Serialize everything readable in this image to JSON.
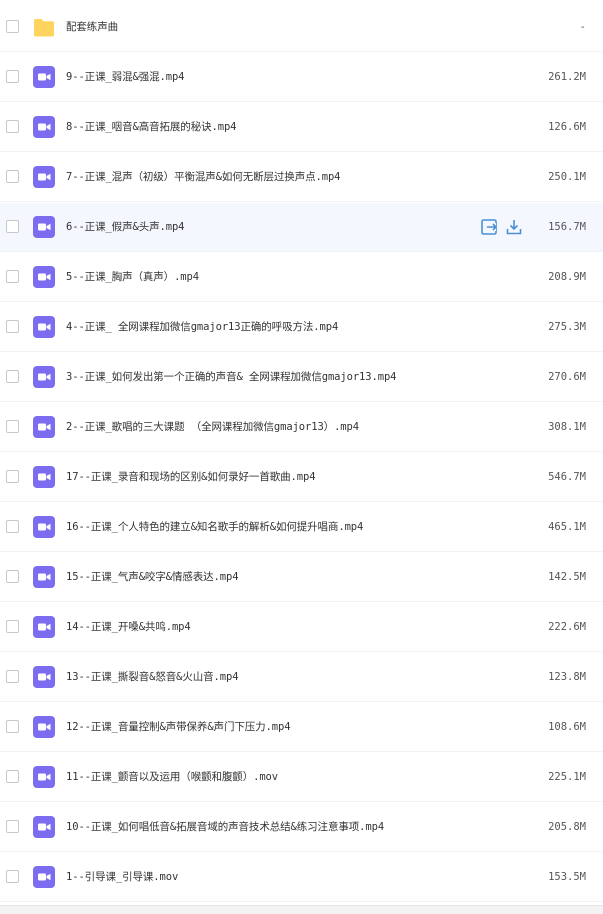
{
  "colors": {
    "folder": "#ffd45e",
    "video_icon": "#7b6cf0",
    "hover_row": "#f4f8fe",
    "action_icon": "#4a90d9"
  },
  "files": [
    {
      "name": "配套练声曲",
      "size": "-",
      "type": "folder",
      "icon": "folder-icon"
    },
    {
      "name": "9--正课_弱混&强混.mp4",
      "size": "261.2M",
      "type": "video",
      "icon": "video-file-icon"
    },
    {
      "name": "8--正课_咽音&高音拓展的秘诀.mp4",
      "size": "126.6M",
      "type": "video",
      "icon": "video-file-icon"
    },
    {
      "name": "7--正课_混声（初级）平衡混声&如何无断层过换声点.mp4",
      "size": "250.1M",
      "type": "video",
      "icon": "video-file-icon"
    },
    {
      "name": "6--正课_假声&头声.mp4",
      "size": "156.7M",
      "type": "video",
      "icon": "video-file-icon",
      "hover": true
    },
    {
      "name": "5--正课_胸声（真声）.mp4",
      "size": "208.9M",
      "type": "video",
      "icon": "video-file-icon"
    },
    {
      "name": "4--正课_ 全网课程加微信gmajor13正确的呼吸方法.mp4",
      "size": "275.3M",
      "type": "video",
      "icon": "video-file-icon"
    },
    {
      "name": "3--正课_如何发出第一个正确的声音& 全网课程加微信gmajor13.mp4",
      "size": "270.6M",
      "type": "video",
      "icon": "video-file-icon"
    },
    {
      "name": "2--正课_歌唱的三大课题 （全网课程加微信gmajor13）.mp4",
      "size": "308.1M",
      "type": "video",
      "icon": "video-file-icon"
    },
    {
      "name": "17--正课_录音和现场的区别&如何录好一首歌曲.mp4",
      "size": "546.7M",
      "type": "video",
      "icon": "video-file-icon"
    },
    {
      "name": "16--正课_个人特色的建立&知名歌手的解析&如何提升唱商.mp4",
      "size": "465.1M",
      "type": "video",
      "icon": "video-file-icon"
    },
    {
      "name": "15--正课_气声&咬字&情感表达.mp4",
      "size": "142.5M",
      "type": "video",
      "icon": "video-file-icon"
    },
    {
      "name": "14--正课_开嗓&共鸣.mp4",
      "size": "222.6M",
      "type": "video",
      "icon": "video-file-icon"
    },
    {
      "name": "13--正课_撕裂音&怒音&火山音.mp4",
      "size": "123.8M",
      "type": "video",
      "icon": "video-file-icon"
    },
    {
      "name": "12--正课_音量控制&声带保养&声门下压力.mp4",
      "size": "108.6M",
      "type": "video",
      "icon": "video-file-icon"
    },
    {
      "name": "11--正课_颤音以及运用（喉颤和腹颤）.mov",
      "size": "225.1M",
      "type": "video",
      "icon": "video-file-icon"
    },
    {
      "name": "10--正课_如何唱低音&拓展音域的声音技术总结&练习注意事项.mp4",
      "size": "205.8M",
      "type": "video",
      "icon": "video-file-icon"
    },
    {
      "name": "1--引导课_引导课.mov",
      "size": "153.5M",
      "type": "video",
      "icon": "video-file-icon"
    }
  ],
  "hover_actions": [
    {
      "icon": "move-to-icon"
    },
    {
      "icon": "download-icon"
    }
  ]
}
